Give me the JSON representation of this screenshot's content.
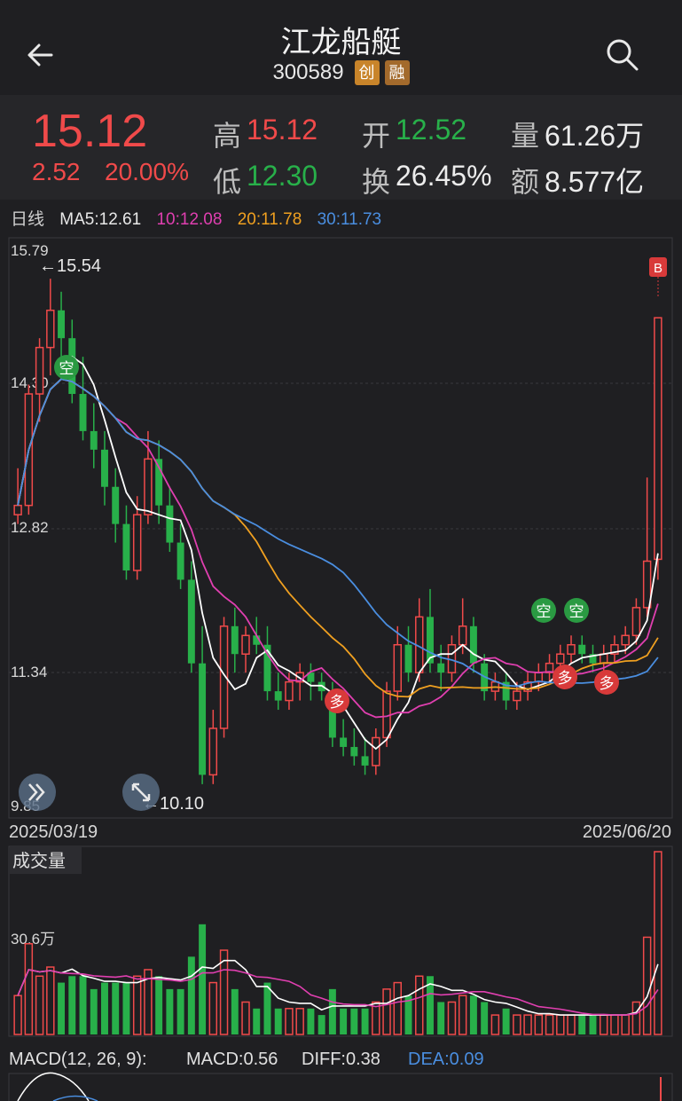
{
  "header": {
    "title": "江龙船艇",
    "code": "300589",
    "tag1": "创",
    "tag2": "融"
  },
  "quote": {
    "price": "15.12",
    "change": "2.52",
    "change_pct": "20.00%",
    "high_label": "高",
    "high": "15.12",
    "low_label": "低",
    "low": "12.30",
    "open_label": "开",
    "open": "12.52",
    "turnover_label": "换",
    "turnover": "26.45%",
    "volume_label": "量",
    "volume": "61.26万",
    "amount_label": "额",
    "amount": "8.577亿"
  },
  "ma": {
    "period_label": "日线",
    "ma5": "MA5:12.61",
    "ma10": "10:12.08",
    "ma20": "20:11.78",
    "ma30": "30:11.73"
  },
  "price_axis": {
    "top": "15.79",
    "mid1": "14.30",
    "mid2": "12.82",
    "mid3": "11.34",
    "bottom": "9.85"
  },
  "annotations": {
    "high_marker": "←15.54",
    "low_marker": "←10.10",
    "signal_short": "空",
    "signal_long": "多",
    "signal_buy": "B"
  },
  "dates": {
    "start": "2025/03/19",
    "end": "2025/06/20"
  },
  "volume_panel": {
    "label": "成交量",
    "level": "30.6万"
  },
  "macd_panel": {
    "label": "MACD(12, 26, 9):",
    "macd": "MACD:0.56",
    "diff": "DIFF:0.38",
    "dea": "DEA:0.09"
  },
  "colors": {
    "up": "#f04a4a",
    "down": "#28b04a",
    "ma5": "#ffffff",
    "ma10": "#e03fb0",
    "ma20": "#f0a020",
    "ma30": "#4a8ee0",
    "tag1": "#c8842a",
    "tag2": "#a36a2c"
  },
  "icons": {
    "back": "back-arrow-icon",
    "search": "search-icon",
    "expand": "double-chevron-icon",
    "collapse": "collapse-icon"
  },
  "chart_data": {
    "type": "candlestick",
    "dates": {
      "start": "2025/03/19",
      "end": "2025/06/20"
    },
    "ylim": [
      9.85,
      15.79
    ],
    "ohlc": [
      [
        13.0,
        13.5,
        12.9,
        13.1
      ],
      [
        13.1,
        14.4,
        13.0,
        14.3
      ],
      [
        14.3,
        14.9,
        14.0,
        14.8
      ],
      [
        14.8,
        15.54,
        14.5,
        15.2
      ],
      [
        15.2,
        15.4,
        14.6,
        14.9
      ],
      [
        14.9,
        15.1,
        14.2,
        14.3
      ],
      [
        14.3,
        14.7,
        13.8,
        13.9
      ],
      [
        13.9,
        14.2,
        13.5,
        13.7
      ],
      [
        13.7,
        13.9,
        13.1,
        13.3
      ],
      [
        13.3,
        13.5,
        12.7,
        12.9
      ],
      [
        12.9,
        13.1,
        12.3,
        12.4
      ],
      [
        12.4,
        13.2,
        12.3,
        13.0
      ],
      [
        13.0,
        13.9,
        12.9,
        13.6
      ],
      [
        13.6,
        13.8,
        12.9,
        13.1
      ],
      [
        13.1,
        13.3,
        12.6,
        12.7
      ],
      [
        12.7,
        12.9,
        12.2,
        12.3
      ],
      [
        12.3,
        12.5,
        11.3,
        11.4
      ],
      [
        11.4,
        11.8,
        10.1,
        10.2
      ],
      [
        10.2,
        10.9,
        10.1,
        10.7
      ],
      [
        10.7,
        11.9,
        10.6,
        11.8
      ],
      [
        11.8,
        12.0,
        11.3,
        11.5
      ],
      [
        11.5,
        11.8,
        11.3,
        11.7
      ],
      [
        11.7,
        11.9,
        11.5,
        11.6
      ],
      [
        11.6,
        11.8,
        11.0,
        11.1
      ],
      [
        11.1,
        11.3,
        10.9,
        11.0
      ],
      [
        11.0,
        11.3,
        10.9,
        11.2
      ],
      [
        11.2,
        11.4,
        11.0,
        11.3
      ],
      [
        11.3,
        11.4,
        11.0,
        11.2
      ],
      [
        11.2,
        11.3,
        11.0,
        11.1
      ],
      [
        11.1,
        11.2,
        10.5,
        10.6
      ],
      [
        10.6,
        10.8,
        10.4,
        10.5
      ],
      [
        10.5,
        10.7,
        10.3,
        10.4
      ],
      [
        10.4,
        10.6,
        10.2,
        10.3
      ],
      [
        10.3,
        10.7,
        10.2,
        10.6
      ],
      [
        10.6,
        11.2,
        10.5,
        11.1
      ],
      [
        11.1,
        11.8,
        11.0,
        11.6
      ],
      [
        11.6,
        11.8,
        11.2,
        11.3
      ],
      [
        11.3,
        12.1,
        11.2,
        11.9
      ],
      [
        11.9,
        12.2,
        11.3,
        11.4
      ],
      [
        11.4,
        11.6,
        11.1,
        11.3
      ],
      [
        11.3,
        11.7,
        11.2,
        11.6
      ],
      [
        11.6,
        12.1,
        11.5,
        11.8
      ],
      [
        11.8,
        11.9,
        11.3,
        11.4
      ],
      [
        11.4,
        11.5,
        11.0,
        11.1
      ],
      [
        11.1,
        11.3,
        11.0,
        11.2
      ],
      [
        11.2,
        11.3,
        10.9,
        11.0
      ],
      [
        11.0,
        11.2,
        10.9,
        11.1
      ],
      [
        11.1,
        11.3,
        11.0,
        11.2
      ],
      [
        11.2,
        11.4,
        11.1,
        11.3
      ],
      [
        11.3,
        11.5,
        11.2,
        11.4
      ],
      [
        11.4,
        11.6,
        11.3,
        11.5
      ],
      [
        11.5,
        11.7,
        11.4,
        11.6
      ],
      [
        11.6,
        11.7,
        11.4,
        11.5
      ],
      [
        11.5,
        11.6,
        11.3,
        11.4
      ],
      [
        11.4,
        11.6,
        11.3,
        11.5
      ],
      [
        11.5,
        11.7,
        11.4,
        11.6
      ],
      [
        11.6,
        11.8,
        11.5,
        11.7
      ],
      [
        11.7,
        12.1,
        11.6,
        12.0
      ],
      [
        12.0,
        13.4,
        11.9,
        12.5
      ],
      [
        12.52,
        15.12,
        12.3,
        15.12
      ]
    ]
  }
}
